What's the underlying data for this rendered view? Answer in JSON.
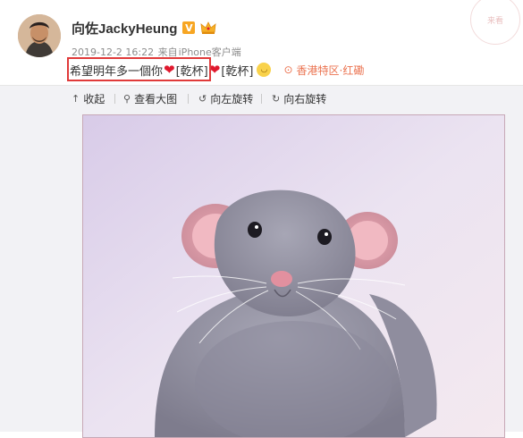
{
  "post": {
    "username": "向佐JackyHeung",
    "verified_badge": "V",
    "timestamp": "2019-12-2 16:22",
    "source_prefix": "来自",
    "source": "iPhone客户端",
    "text": {
      "main": "希望明年多一個你",
      "emoji_text_1": "[乾杯]",
      "emoji_text_2": "[乾杯]"
    },
    "location": "香港特区·红磡",
    "icons": {
      "heart": "heart-icon",
      "grin": "grin-emoji-icon",
      "location": "location-pin-icon"
    },
    "colors": {
      "heart": "#e0192e",
      "location": "#eb7350",
      "highlight_box": "#e03a3a",
      "badge": "#f7a623"
    }
  },
  "toolbar": {
    "collapse": "收起",
    "view_large": "查看大图",
    "rotate_left": "向左旋转",
    "rotate_right": "向右旋转"
  },
  "watermark": "来看"
}
